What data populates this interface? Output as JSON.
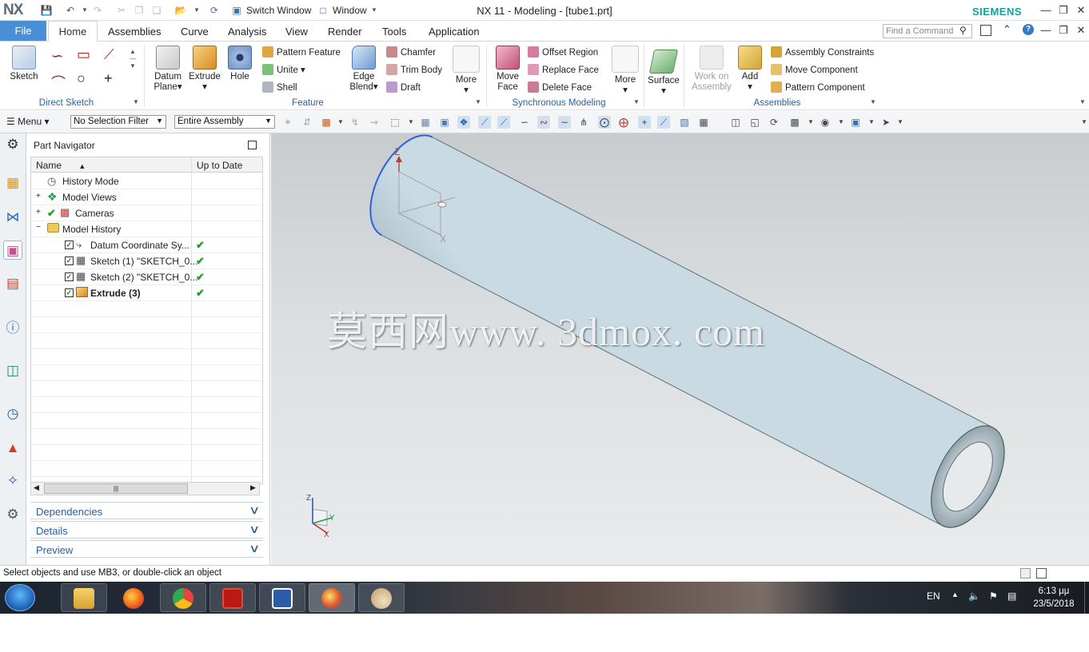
{
  "titlebar": {
    "logo": "NX",
    "switch_window": "Switch Window",
    "window_menu": "Window",
    "title": "NX 11 - Modeling - [tube1.prt]",
    "brand": "SIEMENS"
  },
  "tabs": {
    "file": "File",
    "home": "Home",
    "items": [
      "Assemblies",
      "Curve",
      "Analysis",
      "View",
      "Render",
      "Tools",
      "Application"
    ],
    "find_placeholder": "Find a Command"
  },
  "ribbon": {
    "sketch": "Sketch",
    "direct_sketch": "Direct Sketch",
    "datum_plane_1": "Datum",
    "datum_plane_2": "Plane",
    "extrude": "Extrude",
    "hole": "Hole",
    "pattern_feature": "Pattern Feature",
    "unite": "Unite",
    "shell": "Shell",
    "edge_blend_1": "Edge",
    "edge_blend_2": "Blend",
    "chamfer": "Chamfer",
    "trim_body": "Trim Body",
    "draft": "Draft",
    "more": "More",
    "feature": "Feature",
    "move_face_1": "Move",
    "move_face_2": "Face",
    "offset_region": "Offset Region",
    "replace_face": "Replace Face",
    "delete_face": "Delete Face",
    "more2": "More",
    "synchronous_modeling": "Synchronous Modeling",
    "surface": "Surface",
    "work_on_assembly_1": "Work on",
    "work_on_assembly_2": "Assembly",
    "add": "Add",
    "assembly_constraints": "Assembly Constraints",
    "move_component": "Move Component",
    "pattern_component": "Pattern Component",
    "assemblies": "Assemblies"
  },
  "selbar": {
    "menu": "Menu",
    "filter": "No Selection Filter",
    "scope": "Entire Assembly"
  },
  "navigator": {
    "title": "Part Navigator",
    "col_name": "Name",
    "col_uptodate": "Up to Date",
    "rows": [
      {
        "label": "History Mode"
      },
      {
        "label": "Model Views"
      },
      {
        "label": "Cameras"
      },
      {
        "label": "Model History"
      },
      {
        "label": "Datum Coordinate Sy..."
      },
      {
        "label": "Sketch (1) \"SKETCH_0..."
      },
      {
        "label": "Sketch (2) \"SKETCH_0..."
      },
      {
        "label": "Extrude (3)"
      }
    ],
    "panels": [
      "Dependencies",
      "Details",
      "Preview"
    ]
  },
  "viewport": {
    "watermark": "莫西网www. 3dmox. com",
    "axis_z": "Z",
    "axis_x": "X",
    "axis_y": "Y",
    "triad_z": "Z",
    "triad_x": "X",
    "triad_y": "Y"
  },
  "status": {
    "text": "Select objects and use MB3, or double-click an object"
  },
  "taskbar": {
    "lang": "EN",
    "time": "6:13 μμ",
    "date": "23/5/2018"
  },
  "colors": {
    "accent": "#4a8fd6",
    "group_label": "#2a5f9e",
    "brand": "#1a9e9e",
    "tube": "#b9cdd8"
  }
}
